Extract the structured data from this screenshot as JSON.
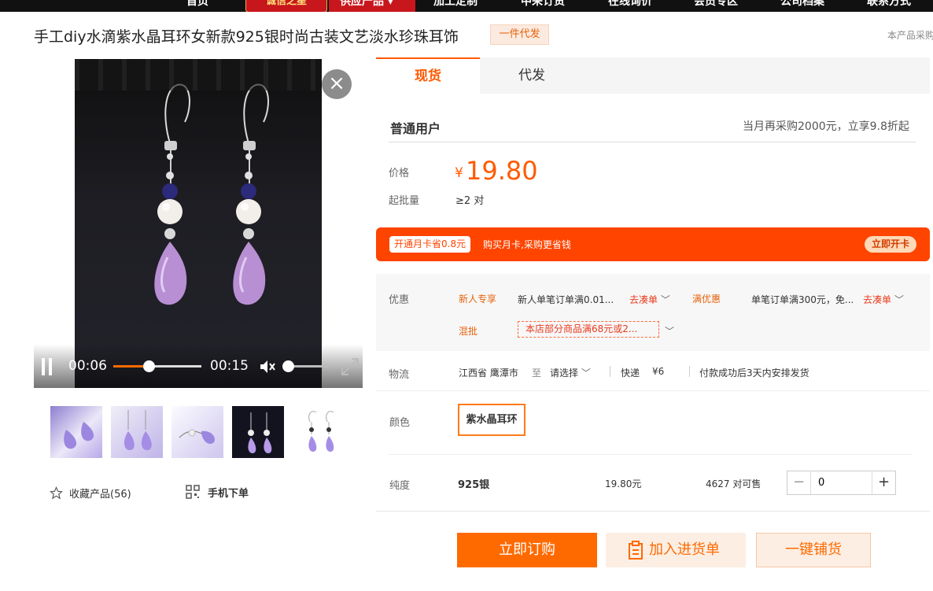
{
  "top_nav": {
    "items": [
      "首页",
      "供应产品",
      "加工定制",
      "中采订货",
      "在线询价",
      "会员专区",
      "公司档案",
      "联系方式"
    ],
    "brand": "诚信之星",
    "active_label": "供应产品 ▾"
  },
  "product": {
    "title": "手工diy水滴紫水晶耳环女新款925银时尚古装文艺淡水珍珠耳饰",
    "badge": "一件代发",
    "right_note": "本产品采购"
  },
  "video": {
    "current_time": "00:06",
    "duration": "00:15",
    "progress": 0.4,
    "volume": 0.0
  },
  "actions": {
    "collect": "收藏产品(56)",
    "mobile_order": "手机下单"
  },
  "tabs": [
    "现货",
    "代发"
  ],
  "pricing": {
    "user_type": "普通用户",
    "user_note": "当月再采购2000元，立享9.8折起",
    "price_label": "价格",
    "currency": "¥",
    "price": "19.80",
    "moq_label": "起批量",
    "moq": "≥2 对"
  },
  "promo": {
    "tag": "开通月卡省0.8元",
    "text": "购买月卡,采购更省钱",
    "button": "立即开卡"
  },
  "discount": {
    "label": "优惠",
    "new_tag": "新人专享",
    "new_text": "新人单笔订单满0.01...",
    "go1": "去凑单",
    "full_tag": "满优惠",
    "full_text": "单笔订单满300元，免...",
    "go2": "去凑单",
    "mix_tag": "混批",
    "mix_text": "本店部分商品满68元或2..."
  },
  "logistics": {
    "label": "物流",
    "from": "江西省 鹰潭市",
    "to_word": "至",
    "select": "请选择",
    "express": "快递",
    "fee": "¥6",
    "ship_note": "付款成功后3天内安排发货"
  },
  "color": {
    "label": "颜色",
    "option": "紫水晶耳环"
  },
  "purity": {
    "label": "纯度",
    "value": "925银",
    "price": "19.80元",
    "stock": "4627 对可售",
    "qty": "0"
  },
  "buttons": {
    "buy": "立即订购",
    "cart": "加入进货单",
    "distribute": "一键铺货"
  },
  "colors": {
    "accent": "#ff6a00",
    "promo_bg": "#ff4400",
    "nav_bg": "#111111",
    "nav_active": "#c8161d"
  }
}
